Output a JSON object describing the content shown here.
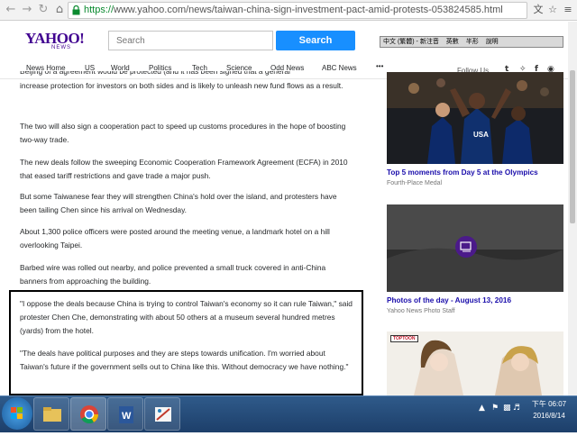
{
  "browser": {
    "url_scheme": "https://",
    "url_rest": "www.yahoo.com/news/taiwan-china-sign-investment-pact-amid-protests-053824585.html"
  },
  "header": {
    "logo": "YAHOO!",
    "logo_sub": "NEWS",
    "search_placeholder": "Search",
    "search_button": "Search",
    "ime_items": [
      "中文 (繁體) - 新注音",
      "英數",
      "半形",
      "說明"
    ]
  },
  "nav": {
    "items": [
      "News Home",
      "US",
      "World",
      "Politics",
      "Tech",
      "Science",
      "Odd News",
      "ABC News",
      "•••"
    ],
    "follow_label": "Follow Us",
    "social": [
      "t",
      "𝕥",
      "f"
    ]
  },
  "article": {
    "partial_line": "Beijing of a agreement would be protected (and it has been signed that a general",
    "paragraphs": [
      "increase protection for investors on both sides and is likely to unleash new fund flows as a result.",
      "The two will also sign a cooperation pact to speed up customs procedures in the hope of boosting two-way trade.",
      "The new deals follow the sweeping Economic Cooperation Framework Agreement (ECFA) in 2010 that eased tariff restrictions and gave trade a major push.",
      "But some Taiwanese fear they will strengthen China's hold over the island, and protesters have been tailing Chen since his arrival on Wednesday.",
      "About 1,300 police officers were posted around the meeting venue, a landmark hotel on a hill overlooking Taipei.",
      "Barbed wire was rolled out nearby, and police prevented a small truck covered in anti-China banners from approaching the building.",
      "\"I oppose the deals because China is trying to control Taiwan's economy so it can rule Taiwan,\" said protester Chen Che, demonstrating with about 50 others at a museum several hundred metres (yards) from the hotel.",
      "\"The deals have political purposes and they are steps towards unification. I'm worried about Taiwan's future if the government sells out to China like this. Without democracy we have nothing.\""
    ]
  },
  "rail": {
    "items": [
      {
        "title": "Top 5 moments from Day 5 at the Olympics",
        "source": "Fourth-Place Medal"
      },
      {
        "title": "Photos of the day - August 13, 2016",
        "source": "Yahoo News Photo Staff"
      },
      {
        "badge": "TOPTOON"
      }
    ]
  },
  "taskbar": {
    "time": "下午 06:07",
    "date": "2016/8/14"
  }
}
